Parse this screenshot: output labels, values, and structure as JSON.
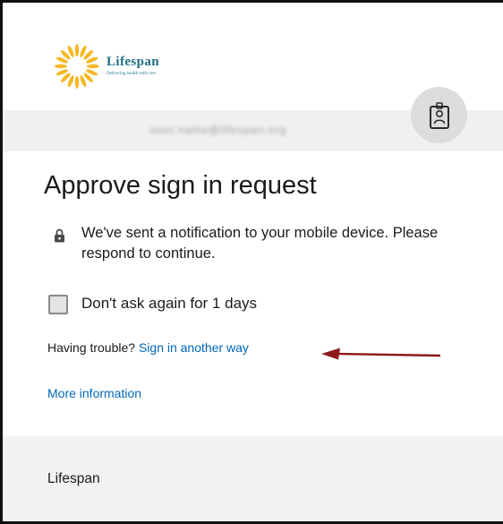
{
  "brand": {
    "name": "Lifespan",
    "tagline": "Delivering health with care",
    "sun_color": "#f5b826",
    "text_color": "#1e6f80"
  },
  "account": {
    "email": "user.name@lifespan.org",
    "icon": "id-badge-icon"
  },
  "title": "Approve sign in request",
  "message": {
    "icon": "lock-icon",
    "text": "We've sent a notification to your mobile device. Please respond to continue."
  },
  "remember": {
    "label": "Don't ask again for 1 days",
    "checked": false
  },
  "trouble": {
    "prefix": "Having trouble?",
    "link": "Sign in another way"
  },
  "annotation": {
    "icon": "arrow-left-icon",
    "color": "#8b1a1a"
  },
  "more_info": "More information",
  "footer": {
    "text": "Lifespan"
  },
  "colors": {
    "link": "#0067b8",
    "band": "#f0f0f0",
    "footer": "#f2f2f2"
  }
}
